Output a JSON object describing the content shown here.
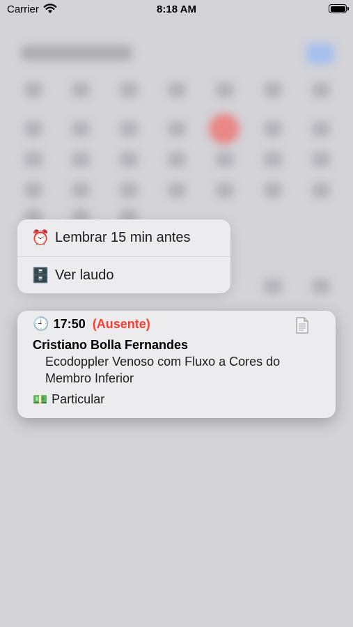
{
  "status_bar": {
    "carrier": "Carrier",
    "time": "8:18 AM"
  },
  "context_menu": {
    "items": [
      {
        "icon": "alarm-clock-icon",
        "glyph": "⏰",
        "label": "Lembrar 15 min antes"
      },
      {
        "icon": "file-cabinet-icon",
        "glyph": "🗄️",
        "label": "Ver laudo"
      }
    ]
  },
  "appointment": {
    "clock_glyph": "🕘",
    "time": "17:50",
    "status": "(Ausente)",
    "status_color": "#ff3b30",
    "patient": "Cristiano Bolla Fernandes",
    "procedure": "Ecodoppler Venoso com Fluxo a Cores do Membro Inferior",
    "payment_glyph": "💵",
    "payment": "Particular"
  }
}
